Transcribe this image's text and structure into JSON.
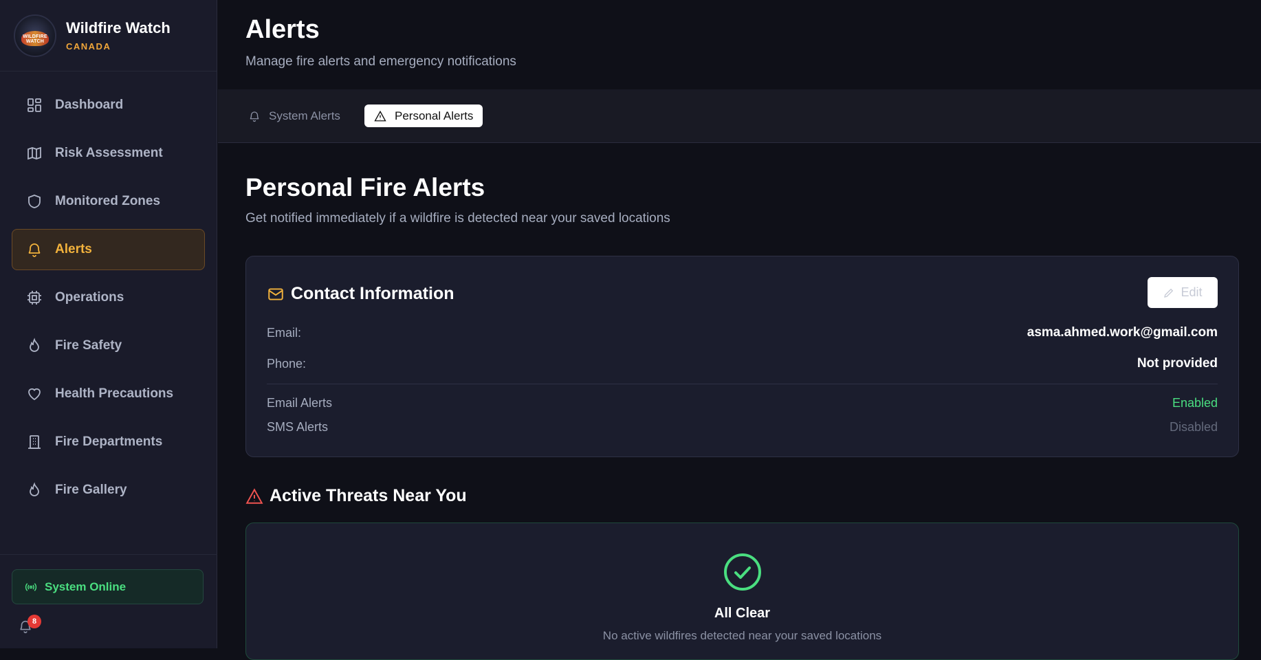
{
  "brand": {
    "title": "Wildfire Watch",
    "subtitle": "CANADA",
    "logo_text": "WILDFIRE WATCH"
  },
  "sidebar": {
    "items": [
      {
        "label": "Dashboard",
        "icon": "dashboard-icon"
      },
      {
        "label": "Risk Assessment",
        "icon": "map-icon"
      },
      {
        "label": "Monitored Zones",
        "icon": "shield-icon"
      },
      {
        "label": "Alerts",
        "icon": "bell-icon",
        "active": true
      },
      {
        "label": "Operations",
        "icon": "cpu-icon"
      },
      {
        "label": "Fire Safety",
        "icon": "flame-icon"
      },
      {
        "label": "Health Precautions",
        "icon": "heart-icon"
      },
      {
        "label": "Fire Departments",
        "icon": "building-icon"
      },
      {
        "label": "Fire Gallery",
        "icon": "flame-icon"
      }
    ],
    "status": "System Online",
    "notification_count": "8"
  },
  "header": {
    "title": "Alerts",
    "subtitle": "Manage fire alerts and emergency notifications"
  },
  "tabs": [
    {
      "label": "System Alerts",
      "icon": "bell-icon",
      "active": false
    },
    {
      "label": "Personal Alerts",
      "icon": "warning-icon",
      "active": true
    }
  ],
  "personal": {
    "title": "Personal Fire Alerts",
    "subtitle": "Get notified immediately if a wildfire is detected near your saved locations"
  },
  "contact": {
    "title": "Contact Information",
    "edit_label": "Edit",
    "email_label": "Email:",
    "email_value": "asma.ahmed.work@gmail.com",
    "phone_label": "Phone:",
    "phone_value": "Not provided",
    "email_alerts_label": "Email Alerts",
    "email_alerts_value": "Enabled",
    "sms_alerts_label": "SMS Alerts",
    "sms_alerts_value": "Disabled"
  },
  "threats": {
    "title": "Active Threats Near You",
    "clear_title": "All Clear",
    "clear_subtitle": "No active wildfires detected near your saved locations"
  },
  "colors": {
    "accent": "#f2b23c",
    "success": "#4ade80",
    "danger": "#ef5350",
    "background": "#0f1018",
    "sidebar": "#1a1b2a"
  }
}
